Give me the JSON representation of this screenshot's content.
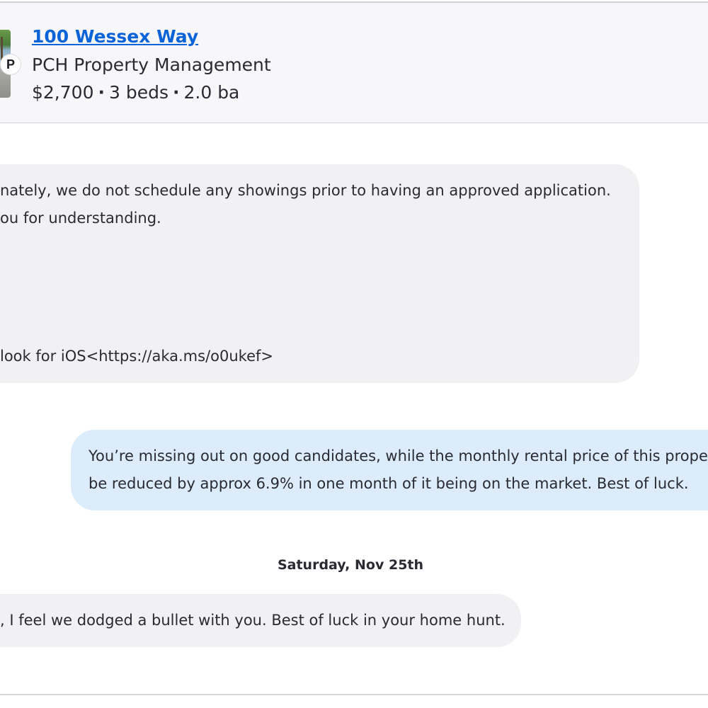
{
  "listing": {
    "address": "100 Wessex Way",
    "manager": "PCH Property Management",
    "avatar_initial": "P",
    "price": "$2,700",
    "beds": "3 beds",
    "baths": "2.0 ba",
    "separator": "·"
  },
  "messages": [
    {
      "direction": "incoming",
      "lines": [
        "nately, we do not schedule any showings prior to having an approved application.",
        "ou for understanding.",
        "look for iOS<https://aka.ms/o0ukef>"
      ]
    },
    {
      "direction": "outgoing",
      "lines": [
        "You’re missing out on good candidates, while the monthly rental price of this prope",
        "be reduced by approx 6.9% in one month of it being on the market. Best of luck."
      ]
    },
    {
      "direction": "incoming",
      "lines": [
        ", I feel we dodged a bullet with you. Best of luck in your home hunt."
      ]
    }
  ],
  "date_separator": "Saturday, Nov 25th",
  "colors": {
    "link": "#0b63d8",
    "incoming_bubble": "#f1f1f3",
    "outgoing_bubble": "#dcecfb",
    "header_bg": "#f7f7f9"
  }
}
